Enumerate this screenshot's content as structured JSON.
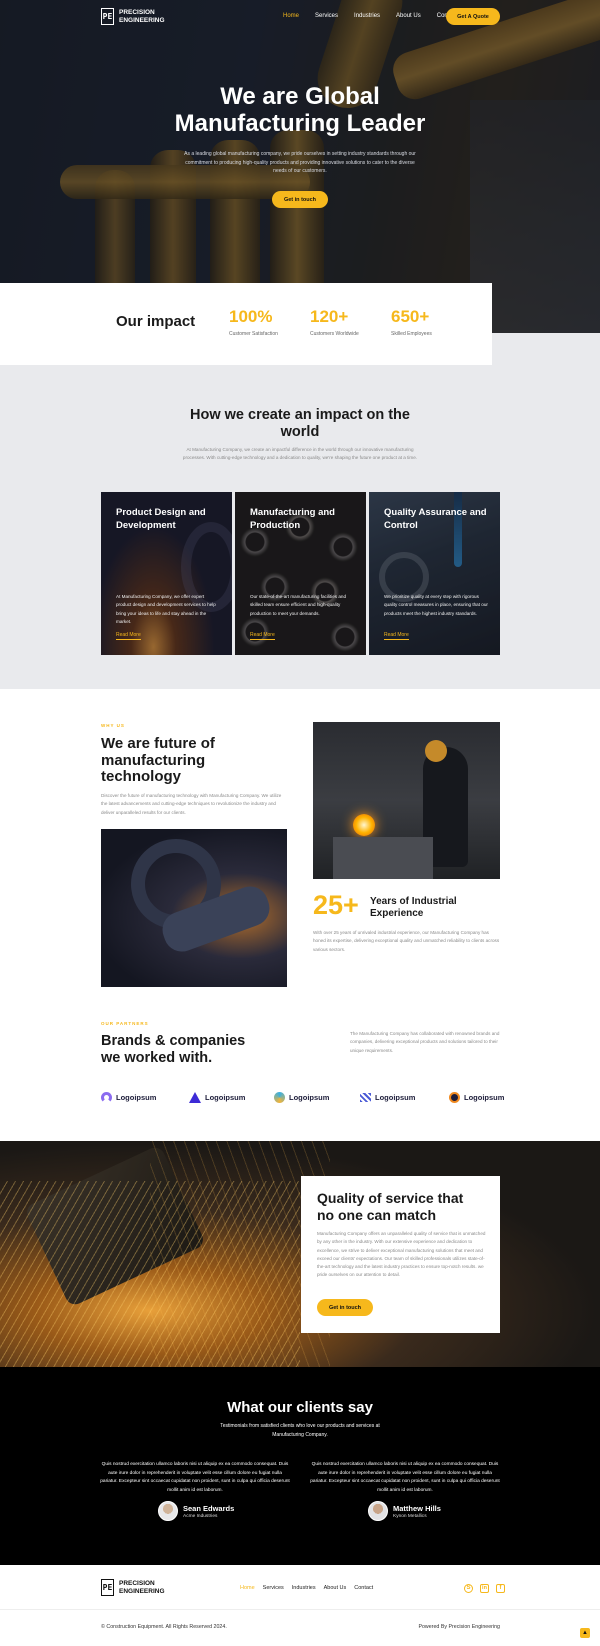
{
  "brand": {
    "mark": "PE",
    "line1": "PRECISION",
    "line2": "ENGINEERING"
  },
  "nav": {
    "items": [
      "Home",
      "Services",
      "Industries",
      "About Us",
      "Contact"
    ],
    "cta": "Get A Quote"
  },
  "hero": {
    "title_line1": "We are Global",
    "title_line2": "Manufacturing Leader",
    "text": "As a leading global manufacturing company, we pride ourselves in setting industry standards through our commitment to producing high-quality products and providing innovative solutions to cater to the diverse needs of our customers.",
    "button": "Get in touch"
  },
  "impact": {
    "title": "Our impact",
    "stats": [
      {
        "value": "100%",
        "label": "Customer Satisfaction"
      },
      {
        "value": "120+",
        "label": "Customers Worldwide"
      },
      {
        "value": "650+",
        "label": "Skilled Employees"
      }
    ]
  },
  "how": {
    "title": "How we create an impact on the world",
    "text": "At Manufacturing Company, we create an impactful difference in the world through our innovative manufacturing processes. With cutting-edge technology and a dedication to quality, we're shaping the future one product at a time.",
    "cards": [
      {
        "title": "Product Design and Development",
        "text": "At Manufacturing Company, we offer expert product design and development services to help bring your ideas to life and stay ahead in the market.",
        "link": "Read More"
      },
      {
        "title": "Manufacturing and Production",
        "text": "Our state-of-the-art manufacturing facilities and skilled team ensure efficient and high-quality production to meet your demands.",
        "link": "Read More"
      },
      {
        "title": "Quality Assurance and Control",
        "text": "We prioritize quality at every step with rigorous quality control measures in place, ensuring that our products meet the highest industry standards.",
        "link": "Read More"
      }
    ]
  },
  "future": {
    "eyebrow": "WHY US",
    "title_l1": "We are future of",
    "title_l2": "manufacturing",
    "title_l3": "technology",
    "text": "Discover the future of manufacturing technology with Manufacturing Company. We utilize the latest advancements and cutting-edge techniques to revolutionize the industry and deliver unparalleled results for our clients.",
    "years": "25+",
    "years_label_l1": "Years of Industrial",
    "years_label_l2": "Experience",
    "years_text": "With over 25 years of unrivaled industrial experience, our Manufacturing Company has honed its expertise, delivering exceptional quality and unmatched reliability to clients across various sectors."
  },
  "partners": {
    "eyebrow": "OUR PARTNERS",
    "title_l1": "Brands & companies",
    "title_l2": "we worked with.",
    "text": "The Manufacturing Company has collaborated with renowned brands and companies, delivering exceptional products and solutions tailored to their unique requirements.",
    "logos": [
      "Logoipsum",
      "Logoipsum",
      "Logoipsum",
      "Logoipsum",
      "Logoipsum"
    ]
  },
  "quality": {
    "title_l1": "Quality of service that",
    "title_l2": "no one can match",
    "text": "Manufacturing Company offers an unparalleled quality of service that is unmatched by any other in the industry. With our extensive experience and dedication to excellence, we strive to deliver exceptional manufacturing solutions that meet and exceed our clients' expectations. Our team of skilled professionals utilizes state-of-the-art technology and the latest industry practices to ensure top-notch results. we pride ourselves on our attention to detail.",
    "button": "Get in touch"
  },
  "testimonials": {
    "title": "What our clients say",
    "subtitle": "Testimonials from satisfied clients who love our products and services at Manufacturing Company.",
    "items": [
      {
        "quote": "Quis nostrud exercitation ullamco laboris nisi ut aliquip ex ea commodo consequat. Duis aute irure dolor in reprehenderit in voluptate velit esse cillum dolore eu fugiat nulla pariatur. Excepteur sint occaecat cupidatat non proident, sunt in culpa qui officia deserunt mollit anim id est laborum.",
        "name": "Sean Edwards",
        "company": "Acme Industries"
      },
      {
        "quote": "Quis nostrud exercitation ullamco laboris nisi ut aliquip ex ea commodo consequat. Duis aute irure dolor in reprehenderit in voluptate velit esse cillum dolore eu fugiat nulla pariatur. Excepteur sint occaecat cupidatat non proident, sunt in culpa qui officia deserunt mollit anim id est laborum.",
        "name": "Matthew Hills",
        "company": "Kynon Metallics"
      }
    ]
  },
  "footer": {
    "nav": [
      "Home",
      "Services",
      "Industries",
      "About Us",
      "Contact"
    ],
    "social": [
      "skype-icon",
      "linkedin-icon",
      "facebook-icon"
    ],
    "copyright": "© Construction Equipment. All Rights Reserved 2024.",
    "powered": "Powered By Precision Engineering"
  },
  "colors": {
    "accent": "#f6b81c",
    "dark": "#000000",
    "light_bg": "#e9eaed"
  }
}
